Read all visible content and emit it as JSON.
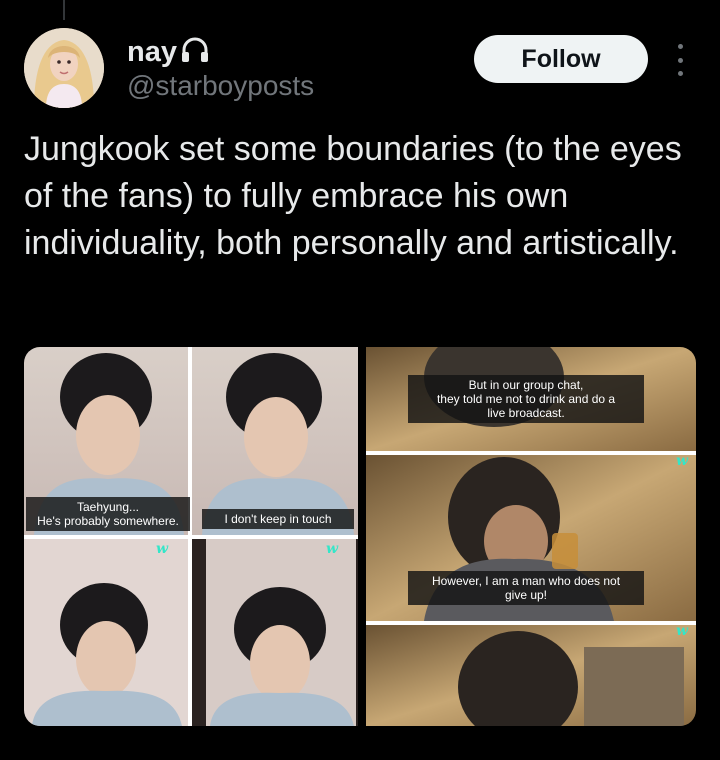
{
  "author": {
    "display_name": "nay",
    "handle": "@starboyposts",
    "badge_icon": "headphones-icon"
  },
  "actions": {
    "follow_label": "Follow",
    "more_icon": "more-vertical-icon"
  },
  "tweet": {
    "text": "Jungkook set some boundaries (to the eyes of the fans) to fully embrace his own individuality, both personally and artistically."
  },
  "media": {
    "captions": {
      "cap1": "Taehyung...\nHe's probably somewhere.",
      "cap2": "I don't keep in touch",
      "cap3": "But in our group chat,\nthey told me not to drink and do a\nlive broadcast.",
      "cap4": "However, I am a man who does not\ngive up!"
    },
    "watermark": "w"
  },
  "colors": {
    "background": "#000000",
    "text": "#e7e9ea",
    "secondary": "#71767b",
    "follow_bg": "#eff3f4",
    "watermark": "#33e6c8"
  }
}
